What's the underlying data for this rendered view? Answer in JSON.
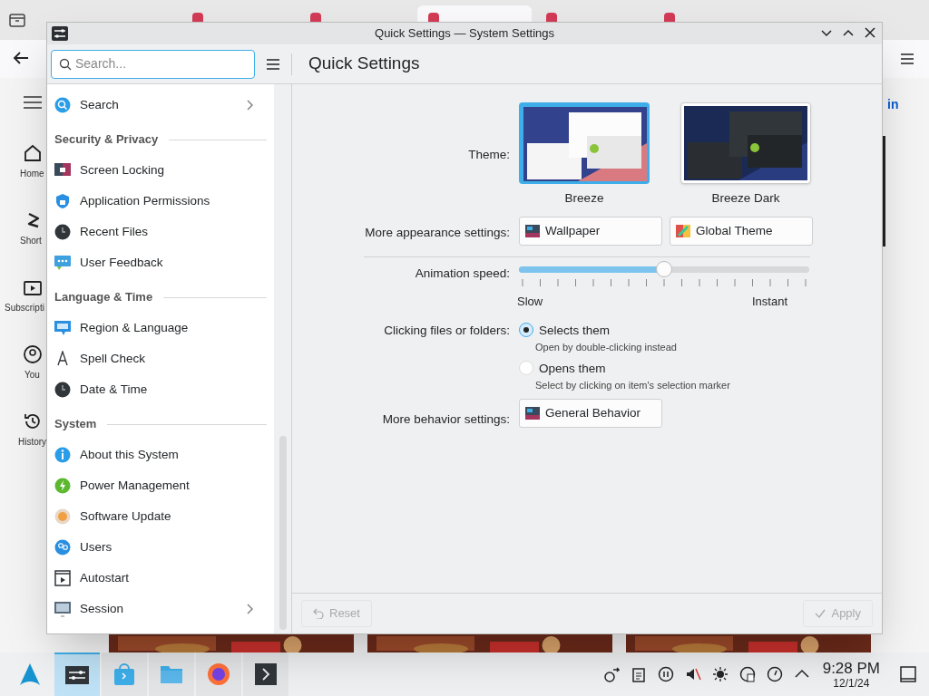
{
  "browser": {
    "nav_items": [
      {
        "label": "Home"
      },
      {
        "label": "Short"
      },
      {
        "label": "Subscripti"
      },
      {
        "label": "You"
      },
      {
        "label": "History"
      }
    ],
    "sign_in": "in"
  },
  "window": {
    "title": "Quick Settings — System Settings"
  },
  "search": {
    "placeholder": "Search..."
  },
  "sidebar": {
    "items": [
      {
        "kind": "item",
        "label": "Search",
        "arrow": true
      },
      {
        "kind": "heading",
        "label": "Security & Privacy"
      },
      {
        "kind": "item",
        "label": "Screen Locking",
        "arrow": false
      },
      {
        "kind": "item",
        "label": "Application Permissions",
        "arrow": false
      },
      {
        "kind": "item",
        "label": "Recent Files",
        "arrow": false
      },
      {
        "kind": "item",
        "label": "User Feedback",
        "arrow": false
      },
      {
        "kind": "heading",
        "label": "Language & Time"
      },
      {
        "kind": "item",
        "label": "Region & Language",
        "arrow": false
      },
      {
        "kind": "item",
        "label": "Spell Check",
        "arrow": false
      },
      {
        "kind": "item",
        "label": "Date & Time",
        "arrow": false
      },
      {
        "kind": "heading",
        "label": "System"
      },
      {
        "kind": "item",
        "label": "About this System",
        "arrow": false
      },
      {
        "kind": "item",
        "label": "Power Management",
        "arrow": false
      },
      {
        "kind": "item",
        "label": "Software Update",
        "arrow": false
      },
      {
        "kind": "item",
        "label": "Users",
        "arrow": false
      },
      {
        "kind": "item",
        "label": "Autostart",
        "arrow": false
      },
      {
        "kind": "item",
        "label": "Session",
        "arrow": true
      }
    ]
  },
  "page_title": "Quick Settings",
  "theme": {
    "label": "Theme:",
    "options": [
      {
        "name": "Breeze",
        "selected": true
      },
      {
        "name": "Breeze Dark",
        "selected": false
      }
    ]
  },
  "appearance": {
    "label": "More appearance settings:",
    "buttons": [
      "Wallpaper",
      "Global Theme"
    ]
  },
  "animation": {
    "label": "Animation speed:",
    "level": 0.5,
    "min_label": "Slow",
    "max_label": "Instant"
  },
  "clicking": {
    "label": "Clicking files or folders:",
    "options": [
      {
        "label": "Selects them",
        "hint": "Open by double-clicking instead",
        "selected": true
      },
      {
        "label": "Opens them",
        "hint": "Select by clicking on item's selection marker",
        "selected": false
      }
    ]
  },
  "behavior": {
    "label": "More behavior settings:",
    "buttons": [
      "General Behavior"
    ]
  },
  "footer": {
    "buttons": [
      {
        "label": "Reset",
        "disabled": true
      },
      {
        "label": "Apply",
        "disabled": true
      }
    ]
  },
  "taskbar": {
    "apps": [
      {
        "selected": false
      },
      {
        "selected": true
      },
      {
        "selected": false
      },
      {
        "selected": false
      },
      {
        "selected": false
      },
      {
        "selected": false
      }
    ],
    "clock": {
      "time": "9:28 PM",
      "date": "12/1/24"
    }
  }
}
